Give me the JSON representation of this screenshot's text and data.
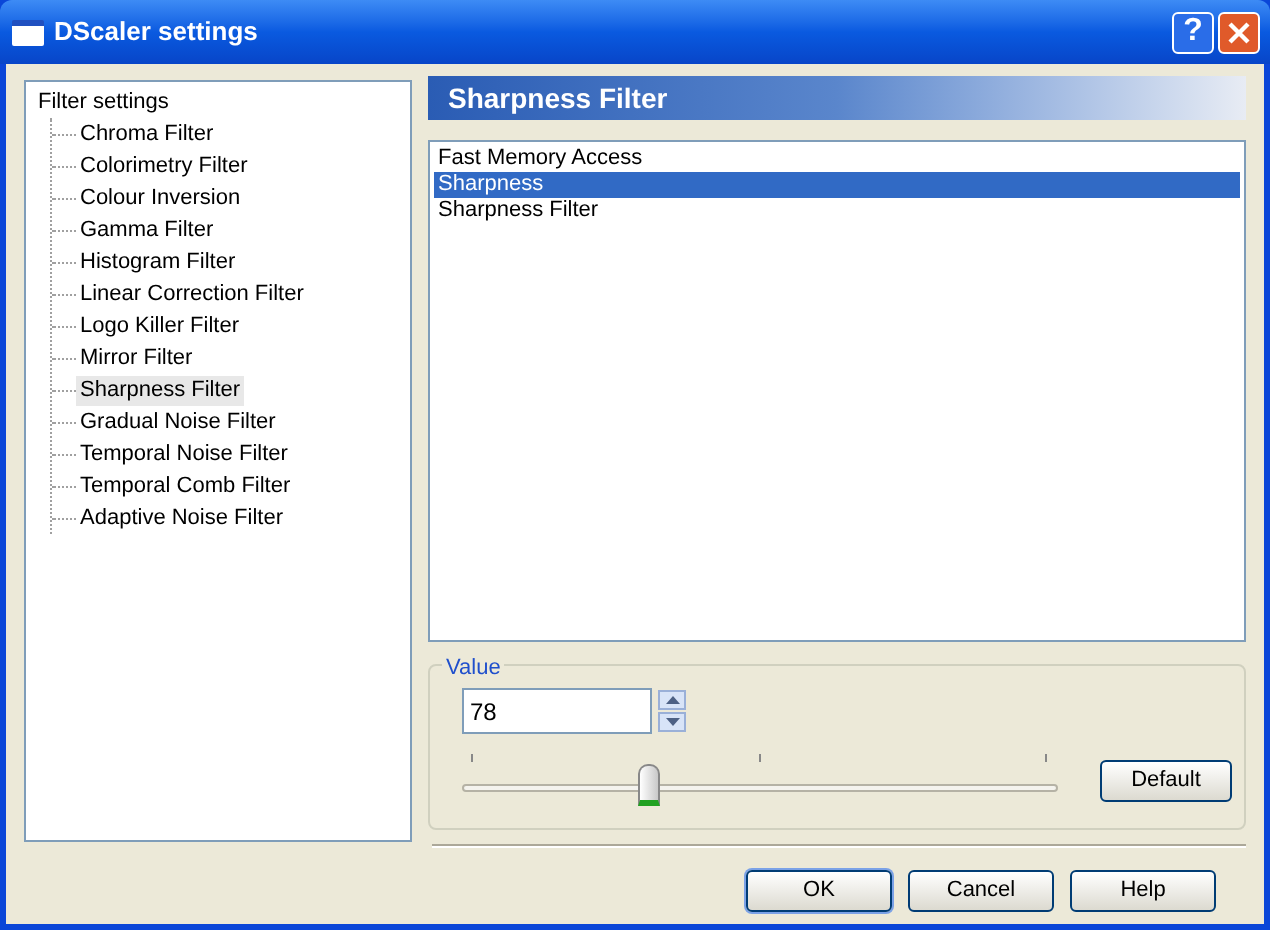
{
  "window": {
    "title": "DScaler settings",
    "help_glyph": "?"
  },
  "tree": {
    "label": "Filter settings",
    "children": [
      {
        "label": "Chroma Filter",
        "selected": false
      },
      {
        "label": "Colorimetry Filter",
        "selected": false
      },
      {
        "label": "Colour Inversion",
        "selected": false
      },
      {
        "label": "Gamma Filter",
        "selected": false
      },
      {
        "label": "Histogram Filter",
        "selected": false
      },
      {
        "label": "Linear Correction Filter",
        "selected": false
      },
      {
        "label": "Logo Killer Filter",
        "selected": false
      },
      {
        "label": "Mirror Filter",
        "selected": false
      },
      {
        "label": "Sharpness Filter",
        "selected": true
      },
      {
        "label": "Gradual Noise Filter",
        "selected": false
      },
      {
        "label": "Temporal Noise Filter",
        "selected": false
      },
      {
        "label": "Temporal Comb Filter",
        "selected": false
      },
      {
        "label": "Adaptive Noise Filter",
        "selected": false
      }
    ]
  },
  "panel": {
    "title": "Sharpness Filter",
    "items": [
      {
        "label": "Fast Memory Access",
        "selected": false
      },
      {
        "label": "Sharpness",
        "selected": true
      },
      {
        "label": "Sharpness Filter",
        "selected": false
      }
    ]
  },
  "value_group": {
    "legend": "Value",
    "value": "78",
    "slider": {
      "level": 0.31
    },
    "default_button": "Default"
  },
  "buttons": [
    "OK",
    "Cancel",
    "Help"
  ]
}
